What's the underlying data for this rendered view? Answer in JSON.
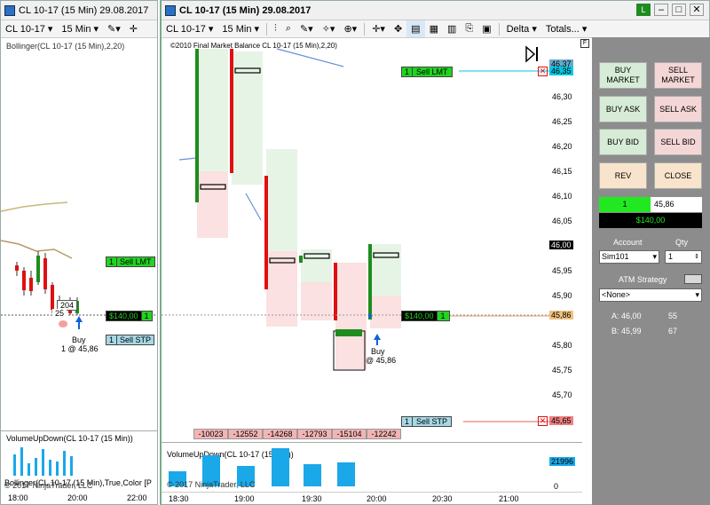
{
  "left_window": {
    "title": "CL 10-17 (15 Min)  29.08.2017",
    "instrument": "CL 10-17",
    "interval": "15 Min",
    "indicator_label": "Bollinger(CL 10-17 (15 Min),2,20)",
    "sell_lmt": "Sell LMT",
    "sell_lmt_qty": "1",
    "pnl": "$140,00",
    "pnl_qty": "1",
    "sell_stp": "Sell STP",
    "sell_stp_qty": "1",
    "bar_value": "204",
    "bar_value2": "25",
    "buy_text": "Buy",
    "buy_fill": "1 @ 45,86",
    "vol_label": "VolumeUpDown(CL 10-17 (15 Min))",
    "bottom_label": "Bollinger(CL 10-17 (15 Min),True,Color [P",
    "copyright": "© 2017 NinjaTrader, LLC",
    "times": [
      "18:00",
      "20:00",
      "22:00"
    ]
  },
  "main_window": {
    "title": "CL 10-17 (15 Min)  29.08.2017",
    "instrument": "CL 10-17",
    "interval": "15 Min",
    "delta_label": "Delta",
    "totals_label": "Totals...",
    "fmb_label": "©2010 Final Market Balance  CL 10-17 (15 Min),2,20)",
    "sell_lmt": "Sell LMT",
    "sell_lmt_qty": "1",
    "sell_stp": "Sell STP",
    "sell_stp_qty": "1",
    "pnl": "$140,00",
    "pnl_qty": "1",
    "buy_text": "Buy",
    "buy_fill": "@ 45,86",
    "vol_label": "VolumeUpDown(CL 10-17 (15 Min))",
    "copyright": "© 2017 NinjaTrader, LLC",
    "vol_axis_value": "21996",
    "vol_axis_zero": "0",
    "totals": [
      "-10023",
      "-12552",
      "-14268",
      "-12793",
      "-15104",
      "-12242"
    ],
    "times": [
      "18:30",
      "19:00",
      "19:30",
      "20:00",
      "20:30",
      "21:00"
    ],
    "price_ticks": [
      "46,30",
      "46,25",
      "46,20",
      "46,15",
      "46,10",
      "46,05",
      "46,00",
      "45,95",
      "45,90",
      "45,85",
      "45,80",
      "45,75",
      "45,70",
      "45,65"
    ],
    "price_tags": {
      "top1": "46,37",
      "top2": "46,35",
      "cur": "46,00",
      "mid": "45,86",
      "low": "45,65"
    }
  },
  "order_panel": {
    "buy_market": "BUY\nMARKET",
    "sell_market": "SELL\nMARKET",
    "buy_ask": "BUY ASK",
    "sell_ask": "SELL ASK",
    "buy_bid": "BUY BID",
    "sell_bid": "SELL BID",
    "rev": "REV",
    "close": "CLOSE",
    "position_qty": "1",
    "position_price": "45,86",
    "pnl": "$140,00",
    "account_label": "Account",
    "qty_label": "Qty",
    "account_value": "Sim101",
    "qty_value": "1",
    "atm_label": "ATM Strategy",
    "atm_value": "<None>",
    "ask_label": "A: 46,00",
    "ask_size": "55",
    "bid_label": "B: 45,99",
    "bid_size": "67"
  },
  "colors": {
    "green": "#1e8c1e",
    "red": "#e01010",
    "sell_lmt_bg": "#22d322",
    "sell_stp_bg": "#a8d8e6",
    "vol_blue": "#1aa8e8",
    "panel_bg": "#8c8c8c"
  }
}
